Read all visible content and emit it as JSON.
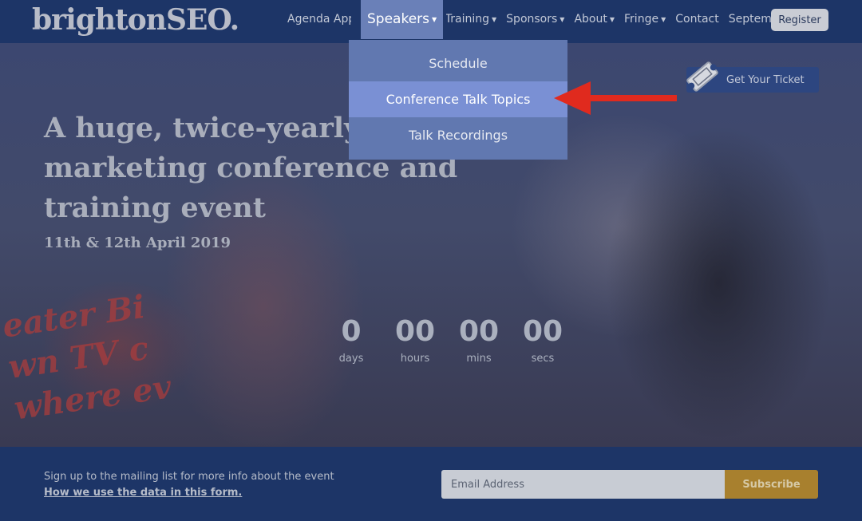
{
  "header": {
    "logo": "brightonSEO.",
    "nav": [
      {
        "label": "Agenda App",
        "caret": false,
        "active": false
      },
      {
        "label": "Speakers",
        "caret": true,
        "active": true
      },
      {
        "label": "Training",
        "caret": true,
        "active": false
      },
      {
        "label": "Sponsors",
        "caret": true,
        "active": false
      },
      {
        "label": "About",
        "caret": true,
        "active": false
      },
      {
        "label": "Fringe",
        "caret": true,
        "active": false
      },
      {
        "label": "Contact",
        "caret": false,
        "active": false
      },
      {
        "label": "September",
        "caret": false,
        "active": false
      }
    ],
    "register_label": "Register"
  },
  "dropdown": {
    "items": [
      "Schedule",
      "Conference Talk Topics",
      "Talk Recordings"
    ],
    "highlighted": "Conference Talk Topics"
  },
  "hero": {
    "title": "A huge, twice-yearly marketing conference and training event",
    "date": "11th & 12th April 2019",
    "ticket_label": "Get Your Ticket",
    "background_text": [
      "eater Bi",
      "wn TV c",
      "where ev"
    ]
  },
  "countdown": [
    {
      "value": "0",
      "label": "days"
    },
    {
      "value": "00",
      "label": "hours"
    },
    {
      "value": "00",
      "label": "mins"
    },
    {
      "value": "00",
      "label": "secs"
    }
  ],
  "footer": {
    "text": "Sign up to the mailing list for more info about the event",
    "link": "How we use the data in this form.",
    "email_placeholder": "Email Address",
    "subscribe_label": "Subscribe"
  },
  "colors": {
    "header_bg": "#1d3567",
    "dropdown_bg": "#6178b0",
    "dropdown_highlight": "#7a90d4",
    "arrow": "#e02a1e",
    "subscribe": "#a8802e"
  },
  "icons": {
    "ticket": "ticket-icon",
    "caret": "chevron-down-icon",
    "arrow": "arrow-left-icon"
  }
}
